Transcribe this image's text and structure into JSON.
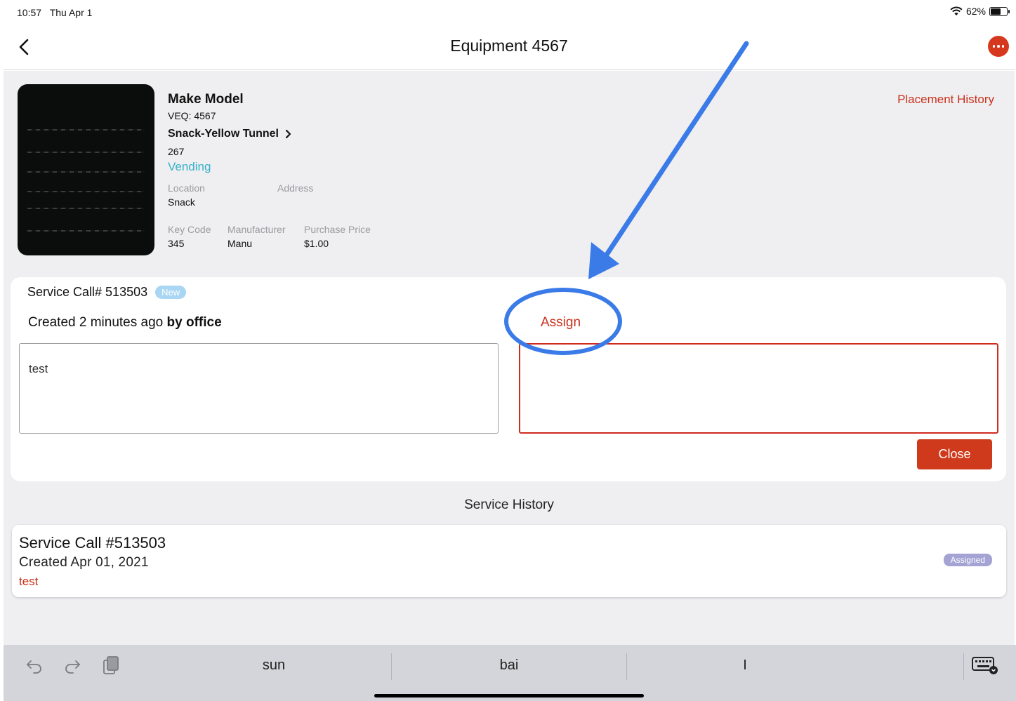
{
  "status_bar": {
    "time": "10:57",
    "date": "Thu Apr 1",
    "battery": "62%",
    "battery_level": 0.62
  },
  "nav": {
    "title": "Equipment 4567",
    "back_icon": "chevron-left-icon",
    "more_icon": "ellipsis-icon"
  },
  "equipment": {
    "name": "Make Model",
    "veq": "VEQ: 4567",
    "type": "Snack-Yellow Tunnel",
    "number": "267",
    "category": "Vending",
    "location_label": "Location",
    "location_value": "Snack",
    "address_label": "Address",
    "address_value": "",
    "key_code_label": "Key Code",
    "key_code_value": "345",
    "manufacturer_label": "Manufacturer",
    "manufacturer_value": "Manu",
    "purchase_price_label": "Purchase Price",
    "purchase_price_value": "$1.00",
    "placement_history": "Placement History"
  },
  "service_call": {
    "title": "Service Call# 513503",
    "status": "New",
    "created_prefix": "Created 2 minutes ago",
    "created_by": "by office",
    "assign_label": "Assign",
    "note": "test",
    "assign_value": "",
    "close_label": "Close"
  },
  "service_history": {
    "title": "Service History",
    "items": [
      {
        "title": "Service Call #513503",
        "created": "Created  Apr 01, 2021",
        "note": "test",
        "status": "Assigned"
      }
    ]
  },
  "keyboard": {
    "suggestions": [
      "sun",
      "bai",
      "I"
    ],
    "icons": [
      "undo-icon",
      "redo-icon",
      "clipboard-icon",
      "keyboard-dismiss-icon"
    ]
  },
  "colors": {
    "accent": "#d6381d",
    "link_red": "#c8301b",
    "vending_blue": "#38b0c9",
    "annotation_blue": "#3a7be8"
  }
}
